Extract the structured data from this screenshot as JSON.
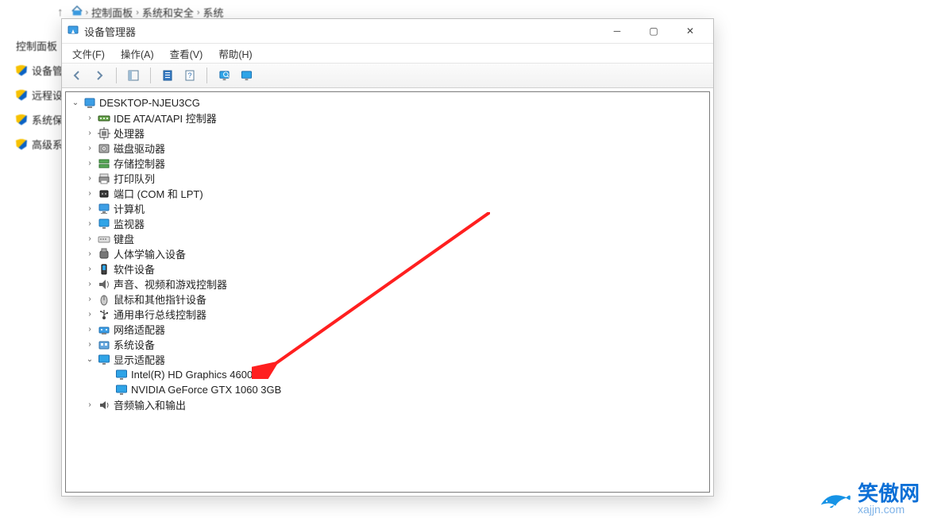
{
  "background": {
    "breadcrumb": [
      "控制面板",
      "系统和安全",
      "系统"
    ],
    "sidebar": [
      "控制面板",
      "设备管理器",
      "远程设置",
      "系统保护",
      "高级系统"
    ]
  },
  "window": {
    "title": "设备管理器",
    "menu": {
      "file": "文件(F)",
      "action": "操作(A)",
      "view": "查看(V)",
      "help": "帮助(H)"
    },
    "toolbar_icons": [
      "back",
      "forward",
      "sep",
      "properties-icon",
      "sep",
      "refresh-icon",
      "monitor-icon",
      "sep",
      "devices-icon",
      "monitor2-icon"
    ],
    "root": "DESKTOP-NJEU3CG",
    "categories": [
      {
        "icon": "ide-icon",
        "label": "IDE ATA/ATAPI 控制器",
        "expanded": false,
        "children": []
      },
      {
        "icon": "cpu-icon",
        "label": "处理器",
        "expanded": false,
        "children": []
      },
      {
        "icon": "disk-icon",
        "label": "磁盘驱动器",
        "expanded": false,
        "children": []
      },
      {
        "icon": "storage-icon",
        "label": "存储控制器",
        "expanded": false,
        "children": []
      },
      {
        "icon": "printer-icon",
        "label": "打印队列",
        "expanded": false,
        "children": []
      },
      {
        "icon": "port-icon",
        "label": "端口 (COM 和 LPT)",
        "expanded": false,
        "children": []
      },
      {
        "icon": "computer-icon",
        "label": "计算机",
        "expanded": false,
        "children": []
      },
      {
        "icon": "monitor-icon",
        "label": "监视器",
        "expanded": false,
        "children": []
      },
      {
        "icon": "keyboard-icon",
        "label": "键盘",
        "expanded": false,
        "children": []
      },
      {
        "icon": "hid-icon",
        "label": "人体学输入设备",
        "expanded": false,
        "children": []
      },
      {
        "icon": "software-icon",
        "label": "软件设备",
        "expanded": false,
        "children": []
      },
      {
        "icon": "sound-icon",
        "label": "声音、视频和游戏控制器",
        "expanded": false,
        "children": []
      },
      {
        "icon": "mouse-icon",
        "label": "鼠标和其他指针设备",
        "expanded": false,
        "children": []
      },
      {
        "icon": "usb-icon",
        "label": "通用串行总线控制器",
        "expanded": false,
        "children": []
      },
      {
        "icon": "network-icon",
        "label": "网络适配器",
        "expanded": false,
        "children": []
      },
      {
        "icon": "system-icon",
        "label": "系统设备",
        "expanded": false,
        "children": []
      },
      {
        "icon": "display-icon",
        "label": "显示适配器",
        "expanded": true,
        "children": [
          {
            "icon": "display-icon",
            "label": "Intel(R) HD Graphics 4600"
          },
          {
            "icon": "display-icon",
            "label": "NVIDIA GeForce GTX 1060 3GB"
          }
        ]
      },
      {
        "icon": "audio-icon",
        "label": "音频输入和输出",
        "expanded": false,
        "children": []
      }
    ]
  },
  "annotation": "arrow pointing to Intel(R) HD Graphics 4600",
  "watermark": {
    "brand": "笑傲网",
    "domain": "xajjn.com"
  },
  "icons": {
    "pc-icon": "<svg viewBox='0 0 16 16'><rect x='2' y='2' width='12' height='9' rx='1' fill='#3c9ee5' stroke='#2471b3'/><rect x='5' y='12' width='6' height='2' fill='#888'/></svg>",
    "ide-icon": "<svg viewBox='0 0 16 16'><rect x='1' y='5' width='14' height='6' rx='1' fill='#6aa84f' stroke='#274e13'/><circle cx='4' cy='8' r='1' fill='#fff'/><circle cx='8' cy='8' r='1' fill='#fff'/><circle cx='12' cy='8' r='1' fill='#fff'/></svg>",
    "cpu-icon": "<svg viewBox='0 0 16 16'><rect x='3' y='3' width='10' height='10' fill='#fff' stroke='#444'/><rect x='5' y='5' width='6' height='6' fill='#888'/><line x1='8' y1='0' x2='8' y2='3' stroke='#444'/><line x1='8' y1='13' x2='8' y2='16' stroke='#444'/><line x1='0' y1='8' x2='3' y2='8' stroke='#444'/><line x1='13' y1='8' x2='16' y2='8' stroke='#444'/></svg>",
    "disk-icon": "<svg viewBox='0 0 16 16'><rect x='2' y='3' width='12' height='10' rx='1' fill='#b0b0b0' stroke='#555'/><circle cx='8' cy='8' r='3' fill='#e0e0e0' stroke='#777'/><circle cx='8' cy='8' r='.8' fill='#555'/></svg>",
    "storage-icon": "<svg viewBox='0 0 16 16'><rect x='2' y='3' width='12' height='4' fill='#57a957' stroke='#2b6e2b'/><rect x='2' y='9' width='12' height='4' fill='#57a957' stroke='#2b6e2b'/></svg>",
    "printer-icon": "<svg viewBox='0 0 16 16'><rect x='3' y='2' width='10' height='4' fill='#ddd' stroke='#888'/><rect x='2' y='6' width='12' height='6' fill='#999' stroke='#555'/><rect x='4' y='10' width='8' height='4' fill='#fff' stroke='#888'/></svg>",
    "port-icon": "<svg viewBox='0 0 16 16'><rect x='3' y='4' width='10' height='8' rx='1' fill='#3b3b3b' stroke='#111'/><circle cx='6' cy='8' r='1' fill='#bfbfbf'/><circle cx='10' cy='8' r='1' fill='#bfbfbf'/></svg>",
    "computer-icon": "<svg viewBox='0 0 16 16'><rect x='2' y='2' width='12' height='8' rx='1' fill='#3c9ee5' stroke='#2471b3'/><rect x='6' y='11' width='4' height='2' fill='#888'/><rect x='4' y='13' width='8' height='1' fill='#888'/></svg>",
    "monitor-icon": "<svg viewBox='0 0 16 16'><rect x='2' y='2' width='12' height='9' rx='1' fill='#2fa4e7' stroke='#1b6fb0'/><rect x='6' y='12' width='4' height='2' fill='#888'/></svg>",
    "keyboard-icon": "<svg viewBox='0 0 16 16'><rect x='1' y='5' width='14' height='7' rx='1' fill='#e0e0e0' stroke='#888'/><rect x='3' y='7' width='2' height='2' fill='#999'/><rect x='6' y='7' width='2' height='2' fill='#999'/><rect x='9' y='7' width='2' height='2' fill='#999'/></svg>",
    "hid-icon": "<svg viewBox='0 0 16 16'><rect x='3' y='4' width='10' height='9' rx='2' fill='#777' stroke='#444'/><rect x='5' y='1' width='6' height='4' fill='#aaa' stroke='#666'/></svg>",
    "software-icon": "<svg viewBox='0 0 16 16'><rect x='5' y='2' width='6' height='12' rx='1' fill='#444' stroke='#111'/><rect x='6' y='3' width='4' height='6' fill='#2fa4e7'/></svg>",
    "sound-icon": "<svg viewBox='0 0 16 16'><path d='M2 6 L6 6 L10 2 L10 14 L6 10 L2 10 Z' fill='#666'/><path d='M12 4 Q15 8 12 12' fill='none' stroke='#666'/></svg>",
    "mouse-icon": "<svg viewBox='0 0 16 16'><ellipse cx='8' cy='9' rx='4' ry='6' fill='#ccc' stroke='#666'/><line x1='8' y1='3' x2='8' y2='9' stroke='#666'/></svg>",
    "usb-icon": "<svg viewBox='0 0 16 16'><circle cx='8' cy='12' r='2' fill='#444'/><path d='M8 12 L8 2 M8 6 L4 4 M8 8 L12 6' fill='none' stroke='#444' stroke-width='1.2'/><circle cx='4' cy='4' r='1' fill='#444'/><rect x='11' y='5' width='2' height='2' fill='#444'/></svg>",
    "network-icon": "<svg viewBox='0 0 16 16'><rect x='2' y='5' width='12' height='7' rx='1' fill='#3c9ee5' stroke='#1b6fb0'/><rect x='5' y='12' width='6' height='2' fill='#888'/><circle cx='5' cy='8' r='1' fill='#fff'/><circle cx='11' cy='8' r='1' fill='#fff'/></svg>",
    "system-icon": "<svg viewBox='0 0 16 16'><rect x='2' y='4' width='12' height='9' rx='1' fill='#67a8de' stroke='#2e72aa'/><rect x='4' y='6' width='3' height='3' fill='#fff'/><rect x='9' y='6' width='3' height='3' fill='#fff'/></svg>",
    "display-icon": "<svg viewBox='0 0 16 16'><rect x='1.5' y='2' width='13' height='9' rx='1' fill='#2fa4e7' stroke='#1b6fb0'/><rect x='6' y='12' width='4' height='2' fill='#888'/></svg>",
    "audio-icon": "<svg viewBox='0 0 16 16'><path d='M3 6 L6 6 L10 3 L10 13 L6 10 L3 10 Z' fill='#555'/><path d='M12 5 Q14 8 12 11' fill='none' stroke='#555'/></svg>",
    "app-icon": "<svg viewBox='0 0 16 16'><rect x='2' y='2' width='12' height='9' rx='1' fill='#3c9ee5' stroke='#2471b3'/><path d='M8 6 L10 11 L6 11 Z' fill='#fff'/></svg>"
  }
}
